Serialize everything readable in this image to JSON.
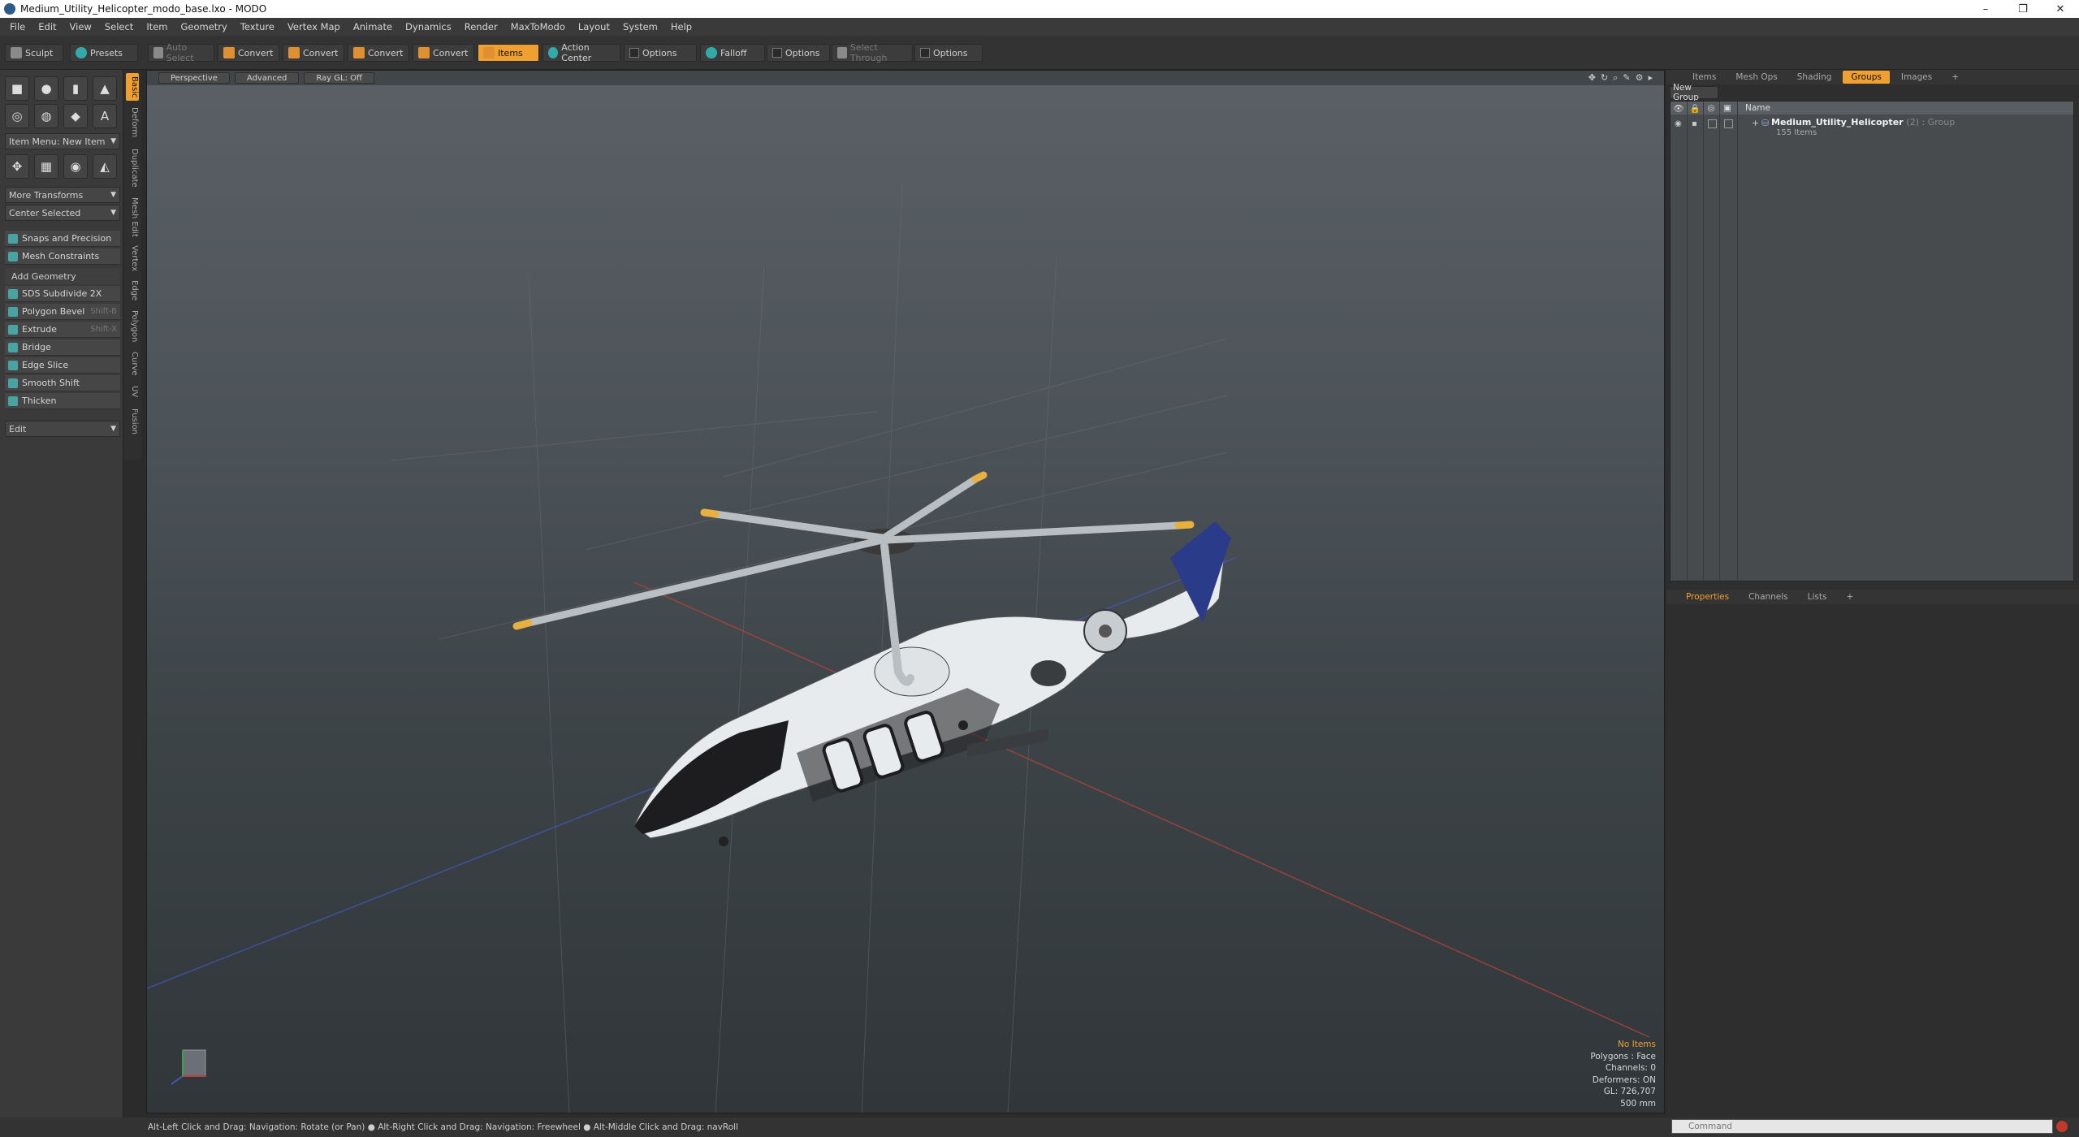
{
  "window": {
    "title": "Medium_Utility_Helicopter_modo_base.lxo - MODO",
    "controls": [
      "–",
      "❐",
      "✕"
    ]
  },
  "menu": [
    "File",
    "Edit",
    "View",
    "Select",
    "Item",
    "Geometry",
    "Texture",
    "Vertex Map",
    "Animate",
    "Dynamics",
    "Render",
    "MaxToModo",
    "Layout",
    "System",
    "Help"
  ],
  "toolbar": {
    "sculpt": "Sculpt",
    "presets": "Presets",
    "auto_select": "Auto Select",
    "convert1": "Convert",
    "convert2": "Convert",
    "convert3": "Convert",
    "convert4": "Convert",
    "items": "Items",
    "action_center": "Action Center",
    "options1": "Options",
    "falloff": "Falloff",
    "options2": "Options",
    "select_through": "Select Through",
    "options3": "Options"
  },
  "left": {
    "item_menu": "Item Menu: New Item",
    "more_transforms": "More Transforms",
    "center_selected": "Center Selected",
    "snaps": "Snaps and Precision",
    "mesh_constraints": "Mesh Constraints",
    "add_geometry": "Add Geometry",
    "tools": [
      {
        "label": "SDS Subdivide 2X",
        "shortcut": ""
      },
      {
        "label": "Polygon Bevel",
        "shortcut": "Shift-B"
      },
      {
        "label": "Extrude",
        "shortcut": "Shift-X"
      },
      {
        "label": "Bridge",
        "shortcut": ""
      },
      {
        "label": "Edge Slice",
        "shortcut": ""
      },
      {
        "label": "Smooth Shift",
        "shortcut": ""
      },
      {
        "label": "Thicken",
        "shortcut": ""
      }
    ],
    "edit_dropdown": "Edit",
    "vtabs": [
      "Basic",
      "Deform",
      "Duplicate",
      "Mesh Edit",
      "Vertex",
      "Edge",
      "Polygon",
      "Curve",
      "UV",
      "Fusion"
    ]
  },
  "viewport": {
    "perspective": "Perspective",
    "advanced": "Advanced",
    "raygl": "Ray GL: Off",
    "info": {
      "no_items": "No Items",
      "polygons": "Polygons : Face",
      "channels": "Channels: 0",
      "deformers": "Deformers: ON",
      "gl": "GL: 726,707",
      "size": "500 mm"
    }
  },
  "right": {
    "tabs": [
      "Items",
      "Mesh Ops",
      "Shading",
      "Groups",
      "Images"
    ],
    "active_tab": "Groups",
    "new_group": "New Group",
    "col_name": "Name",
    "group_name": "Medium_Utility_Helicopter",
    "group_meta": "(2) : Group",
    "group_sub": "155 Items",
    "bottom_tabs": [
      "Properties",
      "Channels",
      "Lists"
    ]
  },
  "status": {
    "hint": "Alt-Left Click and Drag: Navigation: Rotate (or Pan) ● Alt-Right Click and Drag: Navigation: Freewheel ● Alt-Middle Click and Drag: navRoll",
    "command_placeholder": "Command"
  }
}
